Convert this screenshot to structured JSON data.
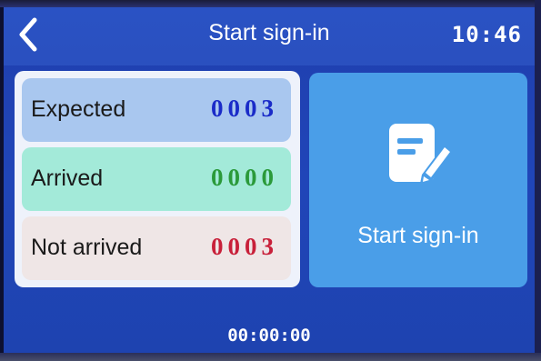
{
  "header": {
    "back_icon": "chevron-left-icon",
    "title": "Start sign-in",
    "time": "10:46"
  },
  "stats": {
    "expected": {
      "label": "Expected",
      "value": "0003",
      "color": "#1a2bc8"
    },
    "arrived": {
      "label": "Arrived",
      "value": "0000",
      "color": "#2b9a3a"
    },
    "not_arrived": {
      "label": "Not arrived",
      "value": "0003",
      "color": "#c8203a"
    }
  },
  "sign_in_button": {
    "icon": "edit-document-icon",
    "label": "Start sign-in"
  },
  "footer": {
    "timer": "00:00:00"
  },
  "colors": {
    "screen_bg": "#2045b8",
    "button_bg": "#4a9ee8"
  }
}
